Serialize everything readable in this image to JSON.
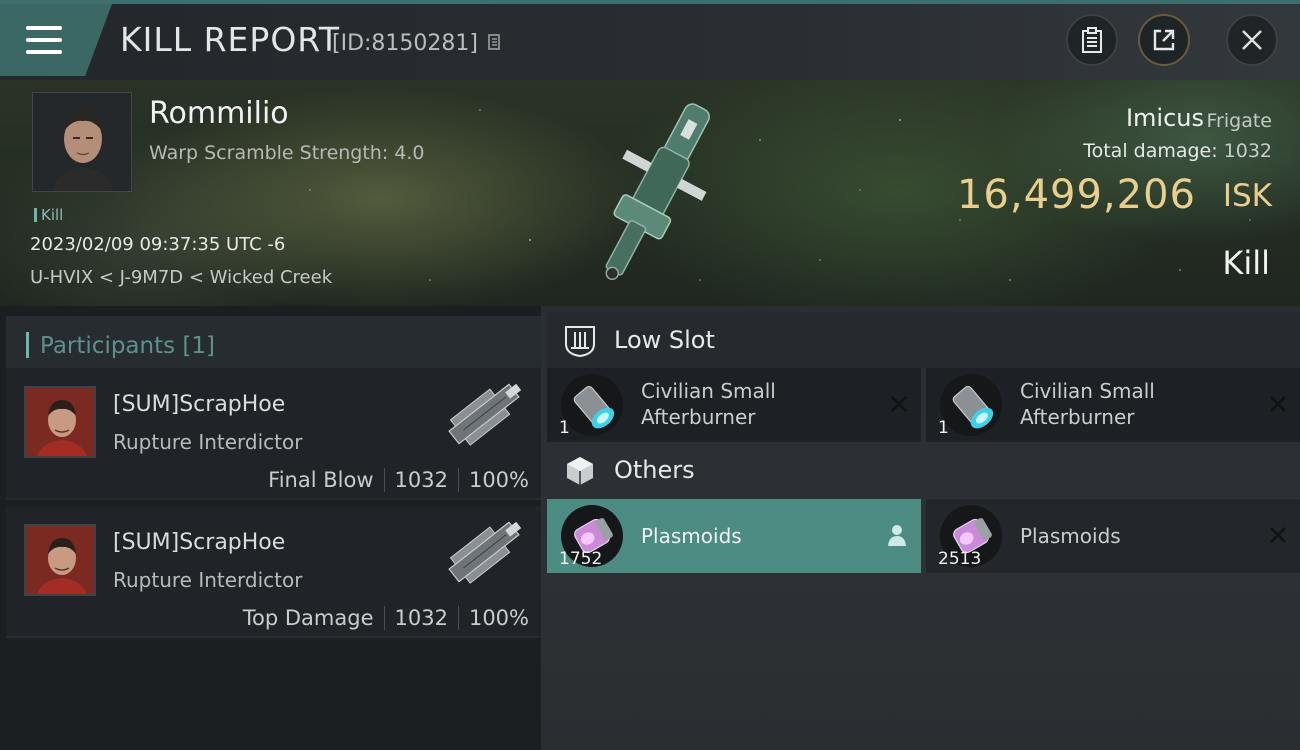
{
  "header": {
    "title": "KILL REPORT",
    "id_text": "[ID:8150281]"
  },
  "victim": {
    "name": "Rommilio",
    "stat": "Warp Scramble Strength: 4.0",
    "tag": "Kill",
    "datetime": "2023/02/09 09:37:35 UTC -6",
    "location": "U-HVIX < J-9M7D < Wicked Creek",
    "ship_name": "Imicus",
    "ship_class": "Frigate",
    "damage_label": "Total damage:",
    "damage_value": "1032",
    "isk_value": "16,499,206",
    "isk_unit": "ISK",
    "result": "Kill"
  },
  "participants": {
    "header": "Participants [1]",
    "rows": [
      {
        "name": "[SUM]ScrapHoe",
        "ship": "Rupture Interdictor",
        "role": "Final Blow",
        "damage": "1032",
        "percent": "100%"
      },
      {
        "name": "[SUM]ScrapHoe",
        "ship": "Rupture Interdictor",
        "role": "Top Damage",
        "damage": "1032",
        "percent": "100%"
      }
    ]
  },
  "slots": {
    "low": {
      "title": "Low Slot",
      "items": [
        {
          "name_line1": "Civilian Small",
          "name_line2": "Afterburner",
          "qty": "1"
        },
        {
          "name_line1": "Civilian Small",
          "name_line2": "Afterburner",
          "qty": "1"
        }
      ]
    },
    "others": {
      "title": "Others",
      "items": [
        {
          "name": "Plasmoids",
          "qty": "1752"
        },
        {
          "name": "Plasmoids",
          "qty": "2513"
        }
      ]
    }
  },
  "colors": {
    "accent_teal": "#6fb6b0",
    "isk_gold": "#e8cf8e",
    "highlight_item": "#4c8c83"
  }
}
